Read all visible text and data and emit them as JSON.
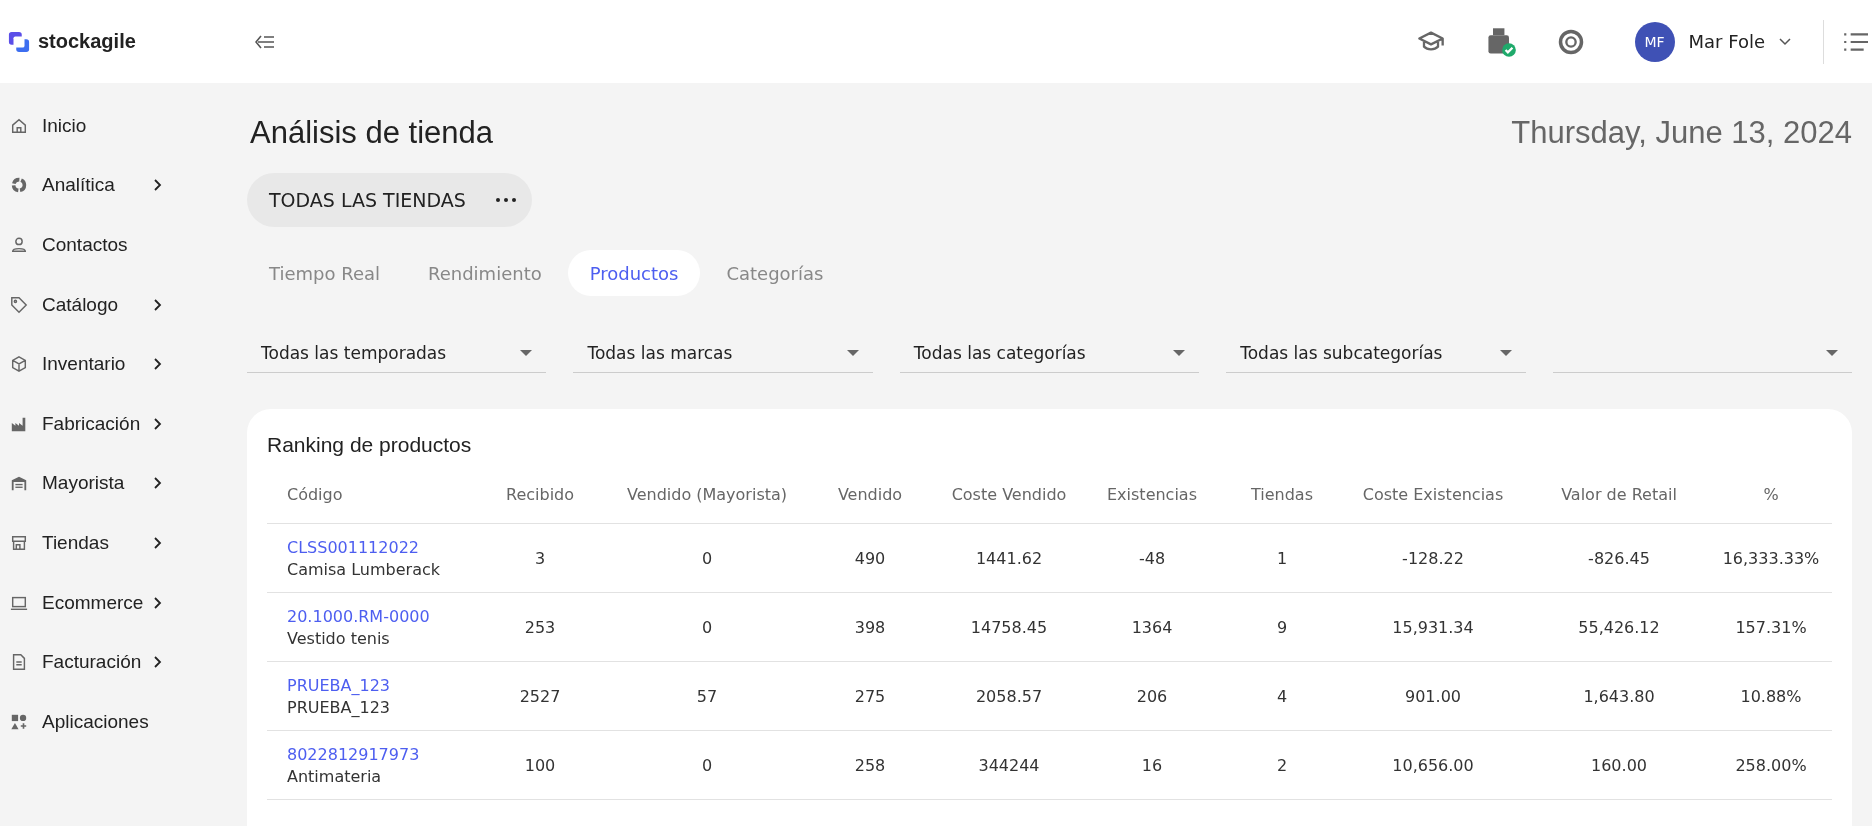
{
  "header": {
    "brand": "stockagile",
    "user": {
      "initials": "MF",
      "name": "Mar Fole"
    }
  },
  "sidebar": {
    "items": [
      {
        "label": "Inicio",
        "has_submenu": false
      },
      {
        "label": "Analítica",
        "has_submenu": true
      },
      {
        "label": "Contactos",
        "has_submenu": false
      },
      {
        "label": "Catálogo",
        "has_submenu": true
      },
      {
        "label": "Inventario",
        "has_submenu": true
      },
      {
        "label": "Fabricación",
        "has_submenu": true
      },
      {
        "label": "Mayorista",
        "has_submenu": true
      },
      {
        "label": "Tiendas",
        "has_submenu": true
      },
      {
        "label": "Ecommerce",
        "has_submenu": true
      },
      {
        "label": "Facturación",
        "has_submenu": true
      },
      {
        "label": "Aplicaciones",
        "has_submenu": false
      }
    ]
  },
  "page": {
    "title": "Análisis de tienda",
    "date": "Thursday, June 13, 2024",
    "store_selector": "TODAS LAS TIENDAS"
  },
  "tabs": [
    {
      "label": "Tiempo Real",
      "selected": false
    },
    {
      "label": "Rendimiento",
      "selected": false
    },
    {
      "label": "Productos",
      "selected": true
    },
    {
      "label": "Categorías",
      "selected": false
    }
  ],
  "filters": [
    {
      "value": "Todas las temporadas"
    },
    {
      "value": "Todas las marcas"
    },
    {
      "value": "Todas las categorías"
    },
    {
      "value": "Todas las subcategorías"
    }
  ],
  "ranking": {
    "title": "Ranking de productos",
    "columns": [
      "Código",
      "Recibido",
      "Vendido (Mayorista)",
      "Vendido",
      "Coste Vendido",
      "Existencias",
      "Tiendas",
      "Coste Existencias",
      "Valor de Retail",
      "%"
    ],
    "rows": [
      {
        "name": "Camisa Lumberack",
        "cells": [
          "CLSS001112022",
          "3",
          "0",
          "490",
          "1441.62",
          "-48",
          "1",
          "-128.22",
          "-826.45",
          "16,333.33%"
        ]
      },
      {
        "name": "Vestido tenis",
        "cells": [
          "20.1000.RM-0000",
          "253",
          "0",
          "398",
          "14758.45",
          "1364",
          "9",
          "15,931.34",
          "55,426.12",
          "157.31%"
        ]
      },
      {
        "name": "PRUEBA_123",
        "cells": [
          "PRUEBA_123",
          "2527",
          "57",
          "275",
          "2058.57",
          "206",
          "4",
          "901.00",
          "1,643.80",
          "10.88%"
        ]
      },
      {
        "name": "Antimateria",
        "cells": [
          "8022812917973",
          "100",
          "0",
          "258",
          "344244",
          "16",
          "2",
          "10,656.00",
          "160.00",
          "258.00%"
        ]
      }
    ]
  }
}
